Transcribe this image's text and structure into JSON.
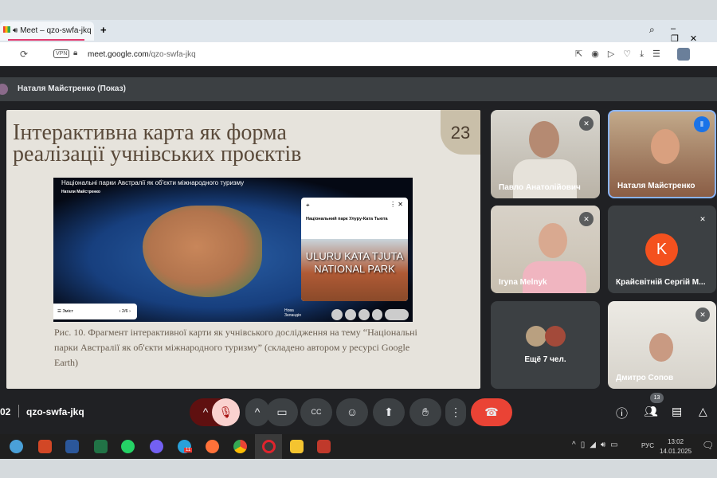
{
  "browser": {
    "tab_title": "Meet – qzo-swfa-jkq",
    "new_tab": "+",
    "url_host": "meet.google.com",
    "url_path": "/qzo-swfa-jkq",
    "vpn": "VPN"
  },
  "presenter": {
    "label": "Наталя Майстренко (Показ)"
  },
  "slide": {
    "title_line1": "Інтерактивна карта як форма",
    "title_line2": "реалізації  учнівських проєктів",
    "number": "23",
    "map": {
      "header": "Національні парки Австралії як об'єкти міжнародного туризму",
      "author": "Натали Майстренко",
      "place_card_title": "Національний парк Улуру-Ката Тьюта",
      "image_text_line1": "ULURU KATA TJUTA",
      "image_text_line2": "NATIONAL PARK",
      "contents_label": "Зміст",
      "page": "2/6",
      "nz_label": "Нова Зеландія"
    },
    "caption": "Рис. 10. Фрагмент інтерактивної карти як учнівського дослідження на тему “Національні парки Австралії як об'єкти міжнародного туризму” (складено автором у ресурсі Google Earth)"
  },
  "participants": [
    {
      "name": "Павло Анатолійович"
    },
    {
      "name": "Наталя Майстренко"
    },
    {
      "name": "Iryna Melnyk"
    },
    {
      "name": "Крайсвітній Сергій М...",
      "initial": "K"
    },
    {
      "name": "Ещё 7 чел."
    },
    {
      "name": "Дмитро Сопов"
    }
  ],
  "controls": {
    "time": "02",
    "meeting_code": "qzo-swfa-jkq",
    "people_count": "13"
  },
  "taskbar": {
    "lang": "РУС",
    "time": "13:02",
    "date": "14.01.2025",
    "telegram_badge": "11"
  }
}
